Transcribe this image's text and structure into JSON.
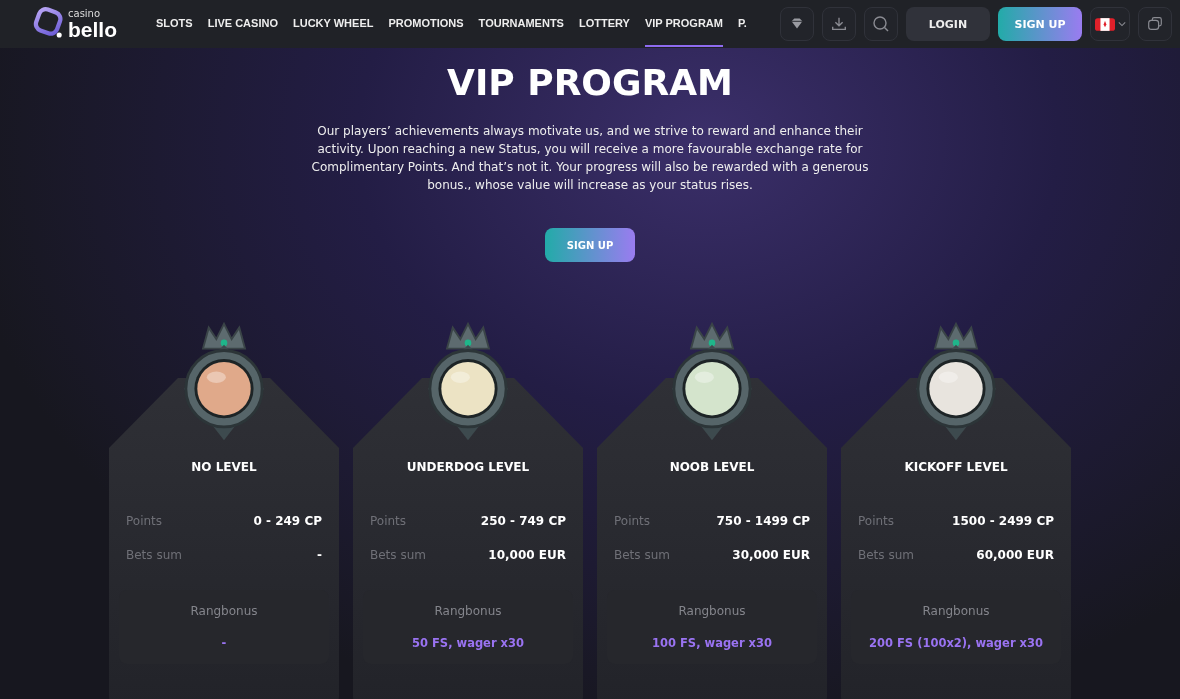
{
  "header": {
    "logo": {
      "small": "casino",
      "big": "bello"
    },
    "nav": [
      {
        "label": "SLOTS",
        "selected": false
      },
      {
        "label": "LIVE CASINO",
        "selected": false
      },
      {
        "label": "LUCKY WHEEL",
        "selected": false
      },
      {
        "label": "PROMOTIONS",
        "selected": false
      },
      {
        "label": "TOURNAMENTS",
        "selected": false
      },
      {
        "label": "LOTTERY",
        "selected": false
      },
      {
        "label": "VIP PROGRAM",
        "selected": true
      },
      {
        "label": "P.",
        "selected": false
      }
    ],
    "login": "LOGIN",
    "signup": "SIGN UP"
  },
  "hero": {
    "title": "VIP PROGRAM",
    "text": "Our players’ achievements always motivate us, and we strive to reward and enhance their activity. Upon reaching a new Status, you will receive a more favourable exchange rate for Complimentary Points. And that’s not it. Your progress will also be rewarded with a generous bonus., whose value will increase as your status rises.",
    "button": "SIGN UP"
  },
  "levels": [
    {
      "name": "NO LEVEL",
      "color": "#e0a98a",
      "points_label": "Points",
      "points": "0 - 249 CP",
      "bets_label": "Bets sum",
      "bets": "-",
      "bonus_label": "Rangbonus",
      "bonus": "-"
    },
    {
      "name": "UNDERDOG LEVEL",
      "color": "#ece3c4",
      "points_label": "Points",
      "points": "250 - 749 CP",
      "bets_label": "Bets sum",
      "bets": "10,000 EUR",
      "bonus_label": "Rangbonus",
      "bonus": "50 FS, wager x30"
    },
    {
      "name": "NOOB LEVEL",
      "color": "#d4e4cc",
      "points_label": "Points",
      "points": "750 - 1499 CP",
      "bets_label": "Bets sum",
      "bets": "30,000 EUR",
      "bonus_label": "Rangbonus",
      "bonus": "100 FS, wager x30"
    },
    {
      "name": "KICKOFF LEVEL",
      "color": "#e8e4de",
      "points_label": "Points",
      "points": "1500 - 2499 CP",
      "bets_label": "Bets sum",
      "bets": "60,000 EUR",
      "bonus_label": "Rangbonus",
      "bonus": "200 FS (100x2), wager x30"
    }
  ]
}
